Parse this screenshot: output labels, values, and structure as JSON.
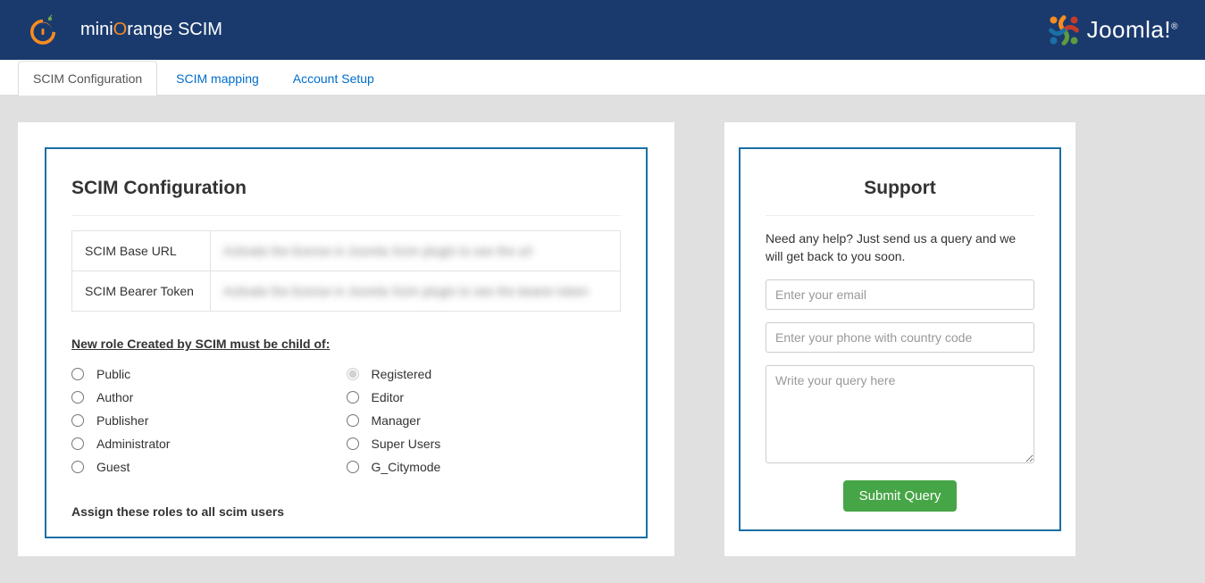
{
  "header": {
    "title_prefix": "mini",
    "title_accent": "O",
    "title_suffix": "range SCIM",
    "joomla_text": "Joomla!"
  },
  "tabs": [
    {
      "label": "SCIM Configuration",
      "active": true
    },
    {
      "label": "SCIM mapping",
      "active": false
    },
    {
      "label": "Account Setup",
      "active": false
    }
  ],
  "main": {
    "title": "SCIM Configuration",
    "rows": [
      {
        "k": "SCIM Base URL",
        "v": "Activate the license in Joomla Scim plugin to see the url"
      },
      {
        "k": "SCIM Bearer Token",
        "v": "Activate the license in Joomla Scim plugin to see the bearer token"
      }
    ],
    "subhead": "New role Created by SCIM must be child of:",
    "roles_left": [
      "Public",
      "Author",
      "Publisher",
      "Administrator",
      "Guest"
    ],
    "roles_right": [
      "Registered",
      "Editor",
      "Manager",
      "Super Users",
      "G_Citymode"
    ],
    "roles_selected": "Registered",
    "assign_head": "Assign these roles to all scim users"
  },
  "support": {
    "title": "Support",
    "text": "Need any help? Just send us a query and we will get back to you soon.",
    "email_placeholder": "Enter your email",
    "phone_placeholder": "Enter your phone with country code",
    "query_placeholder": "Write your query here",
    "submit_label": "Submit Query"
  }
}
